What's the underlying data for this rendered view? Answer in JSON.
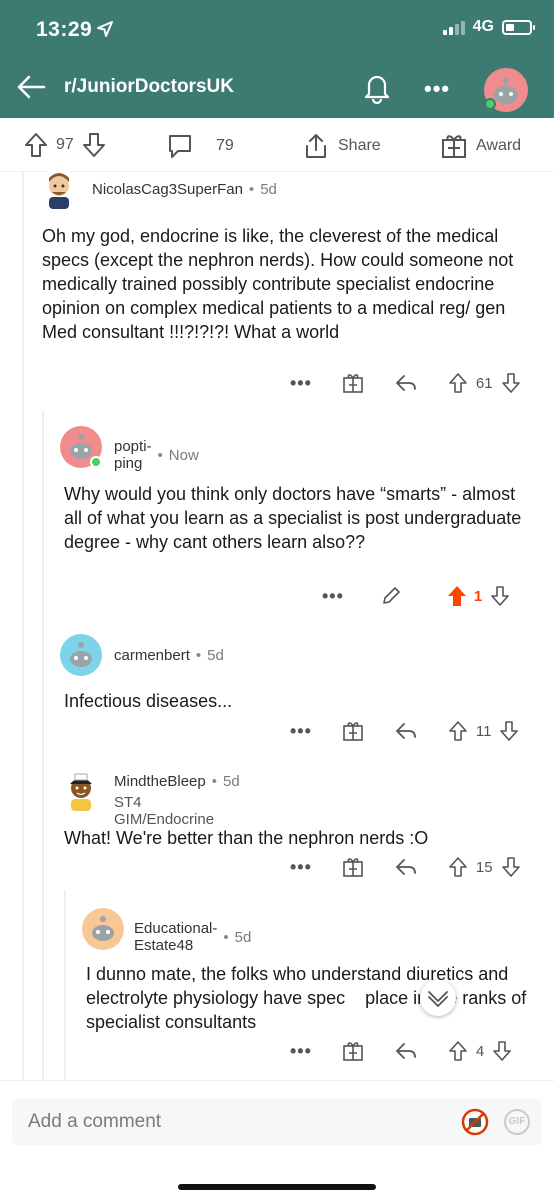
{
  "status_bar": {
    "time": "13:29",
    "network": "4G"
  },
  "nav": {
    "title": "r/JuniorDoctorsUK",
    "back_icon": "arrow-left-icon",
    "bell_icon": "bell-icon",
    "more_label": "•••"
  },
  "post_actions": {
    "upvotes": "97",
    "comments": "79",
    "share_label": "Share",
    "award_label": "Award"
  },
  "comments": [
    {
      "author": "NicolasCag3SuperFan",
      "time": "5d",
      "body": "Oh my god, endocrine is like, the cleverest of the medical specs (except the nephron nerds). How could someone not medically trained possibly contribute specialist endocrine opinion on complex medical patients to a medical reg/ gen Med consultant !!!?!?!?! What a world",
      "score": "61"
    },
    {
      "author": "popti-ping",
      "time": "Now",
      "body": "Why would you think only doctors have “smarts” - almost all of what you learn as a specialist is post undergraduate degree - why cant others learn also??",
      "score": "1"
    },
    {
      "author": "carmenbert",
      "time": "5d",
      "body": "Infectious diseases...",
      "score": "11"
    },
    {
      "author": "MindtheBleep",
      "time": "5d",
      "flair": "ST4 GIM/Endocrine",
      "body": "What! We're better than the nephron nerds :O",
      "score": "15"
    },
    {
      "author": "Educational-Estate48",
      "time": "5d",
      "body": "I dunno mate, the folks who understand diuretics and electrolyte physiology have spec    place in the ranks of specialist consultants",
      "score": "4"
    }
  ],
  "common": {
    "dot": "•",
    "more": "•••"
  },
  "composer": {
    "placeholder": "Add a comment",
    "gif_label": "GIF"
  },
  "colors": {
    "header": "#3c7a72",
    "upvote_active": "#ff4500",
    "online": "#46d160"
  }
}
